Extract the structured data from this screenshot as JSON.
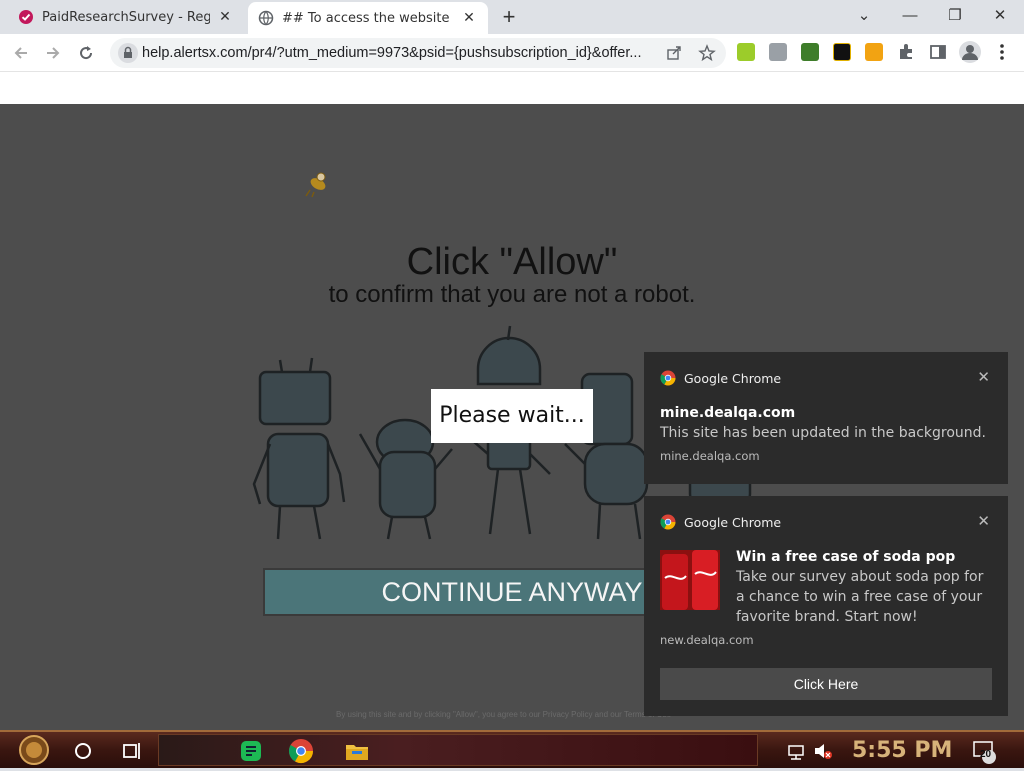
{
  "browser": {
    "tabs": [
      {
        "title": "PaidResearchSurvey - Register",
        "active": false
      },
      {
        "title": "## To access the website click",
        "active": true
      }
    ],
    "new_tab": "+",
    "window_controls": {
      "minimize": "—",
      "maximize": "❐",
      "close": "✕",
      "tab_search": "⌄"
    },
    "url": "help.alertsx.com/pr4/?utm_medium=9973&psid={pushsubscription_id}&offer...",
    "icons": [
      "back-arrow-icon",
      "forward-arrow-icon",
      "reload-icon",
      "lock-icon",
      "share-icon",
      "star-icon",
      "extensions-icon",
      "sidebar-icon",
      "profile-icon",
      "menu-icon"
    ]
  },
  "page": {
    "headline": "Click \"Allow\"",
    "subline": "to confirm that you are not a robot.",
    "wait_text": "Please wait...",
    "continue_label": "CONTINUE ANYWAY",
    "legal_text": "By using this site and by clicking \"Allow\", you agree to our Privacy Policy and our Terms of Use"
  },
  "notifications": [
    {
      "app": "Google Chrome",
      "title": "mine.dealqa.com",
      "body": "This site has been updated in the background.",
      "source": "mine.dealqa.com"
    },
    {
      "app": "Google Chrome",
      "title": "Win a free case of soda pop",
      "body": "Take our survey about soda pop for a chance to win a free case of your favorite brand. Start now!",
      "source": "new.dealqa.com",
      "action": "Click Here"
    }
  ],
  "taskbar": {
    "clock": "5:55 PM",
    "notification_count": "20"
  },
  "colors": {
    "page_bg": "#4d4d4d",
    "continue_bg": "#4b7579",
    "notif_bg": "#2b2b2b",
    "clock": "#d7b37a"
  }
}
